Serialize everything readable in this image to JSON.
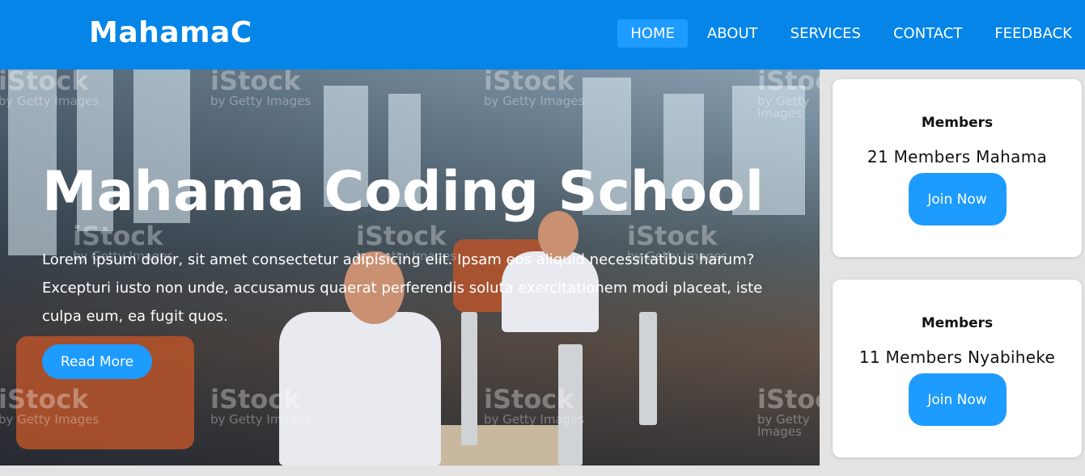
{
  "navbar": {
    "logo": "MahamaC",
    "links": [
      "HOME",
      "ABOUT",
      "SERVICES",
      "CONTACT",
      "FEEDBACK"
    ],
    "active": "HOME"
  },
  "hero": {
    "title": "Mahama Coding School",
    "text": "Lorem ipsum dolor, sit amet consectetur adipisicing elit. Ipsam eos aliquid necessitatibus harum? Excepturi iusto non unde, accusamus quaerat perferendis soluta exercitationem modi placeat, iste culpa eum, ea fugit quos.",
    "button_label": "Read More",
    "watermark_brand": "iStock",
    "watermark_sub": "by Getty Images"
  },
  "cards": [
    {
      "title": "Members",
      "count": "21 Members Mahama",
      "button_label": "Join Now"
    },
    {
      "title": "Members",
      "count": "11 Members Nyabiheke",
      "button_label": "Join Now"
    }
  ],
  "colors": {
    "navbar": "#0585e8",
    "accent": "#1e9bff",
    "page_background": "#e3e3e3"
  }
}
